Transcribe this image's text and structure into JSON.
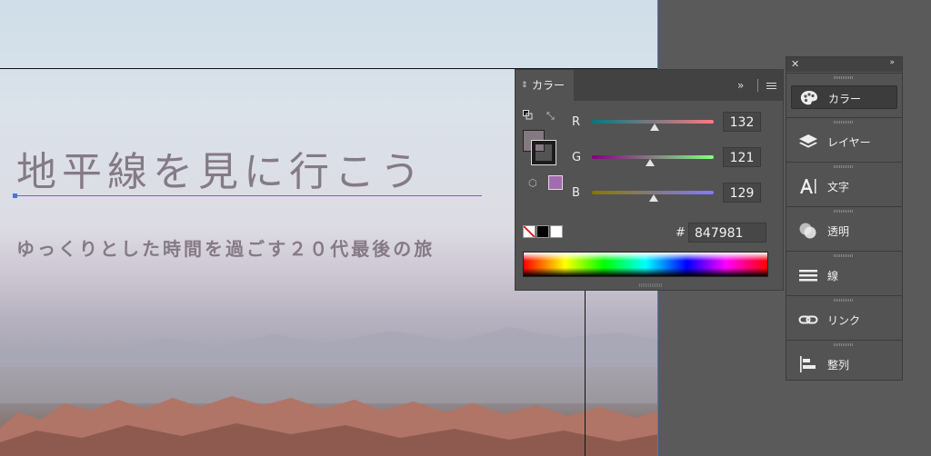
{
  "artboard": {
    "title": "地平線を見に行こう",
    "subtitle": "ゆっくりとした時間を過ごす２０代最後の旅"
  },
  "color_panel": {
    "tab_label": "カラー",
    "expand_icon": "double-chevron-icon",
    "channels": [
      {
        "name": "R",
        "value": "132",
        "level": 0.518
      },
      {
        "name": "G",
        "value": "121",
        "level": 0.475
      },
      {
        "name": "B",
        "value": "129",
        "level": 0.506
      }
    ],
    "hash_label": "#",
    "hex_value": "847981",
    "fill_color": "#847981",
    "websafe_color": "#a36cb0"
  },
  "dock": {
    "items": [
      {
        "label": "カラー",
        "icon": "palette-icon",
        "active": true
      },
      {
        "label": "レイヤー",
        "icon": "layers-icon",
        "active": false
      },
      {
        "label": "文字",
        "icon": "character-icon",
        "active": false
      },
      {
        "label": "透明",
        "icon": "transparency-icon",
        "active": false
      },
      {
        "label": "線",
        "icon": "stroke-icon",
        "active": false
      },
      {
        "label": "リンク",
        "icon": "link-icon",
        "active": false
      },
      {
        "label": "整列",
        "icon": "align-icon",
        "active": false
      }
    ]
  }
}
